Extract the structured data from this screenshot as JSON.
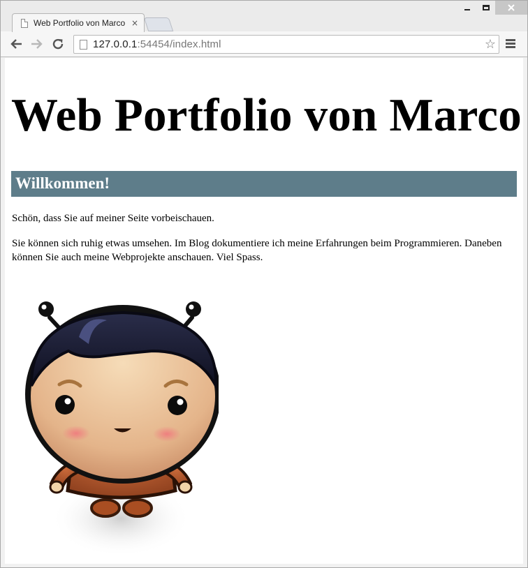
{
  "browser": {
    "tab_title": "Web Portfolio von Marco",
    "tab_close": "×",
    "url_host": "127.0.0.1",
    "url_rest": ":54454/index.html",
    "icons": {
      "back": "back-arrow-icon",
      "forward": "forward-arrow-icon",
      "reload": "reload-icon",
      "bookmark": "star-icon",
      "menu": "menu-icon"
    }
  },
  "page": {
    "title": "Web Portfolio von Marco",
    "section_heading": "Willkommen!",
    "section_color": "#5e7d8a",
    "paragraphs": [
      "Schön, dass Sie auf meiner Seite vorbeischauen.",
      "Sie können sich ruhig etwas umsehen. Im Blog dokumentiere ich meine Erfahrungen beim Programmieren. Daneben können Sie auch meine Webprojekte anschauen. Viel Spass."
    ]
  }
}
